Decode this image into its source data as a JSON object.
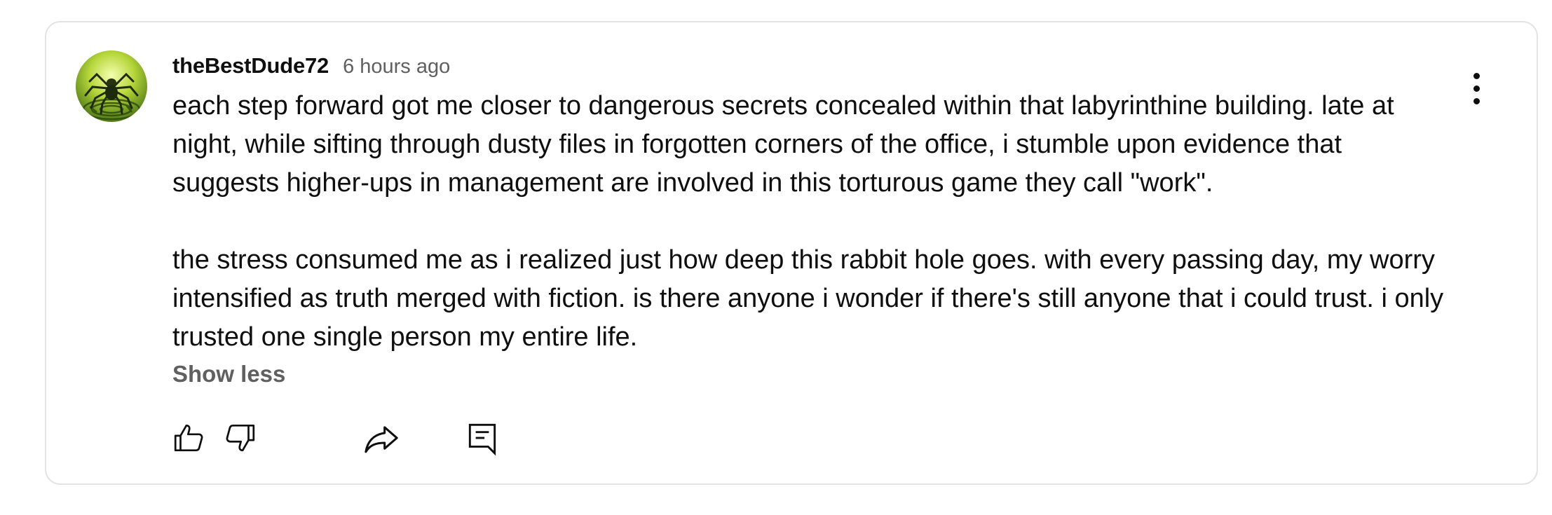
{
  "comment": {
    "author": "theBestDude72",
    "timestamp": "6 hours ago",
    "paragraphs": [
      "each step forward got me closer to dangerous secrets concealed within that labyrinthine building. late at night, while sifting through dusty files in forgotten corners of the office, i stumble upon evidence that suggests higher-ups in management are involved in this torturous game they call \"work\".",
      "the stress consumed me as i realized just how deep this rabbit hole goes. with every passing day, my worry intensified as truth merged with fiction. is there anyone i wonder if there's still anyone that i could trust. i only trusted one single person my entire life."
    ],
    "show_less_label": "Show less"
  },
  "icons": {
    "avatar": "spider-maze-avatar",
    "like": "thumbs-up-icon",
    "dislike": "thumbs-down-icon",
    "share": "share-arrow-icon",
    "reply": "reply-comment-icon",
    "menu": "more-vertical-icon"
  },
  "colors": {
    "text_primary": "#0f0f0f",
    "text_secondary": "#606060",
    "border": "#e3e3e3"
  }
}
